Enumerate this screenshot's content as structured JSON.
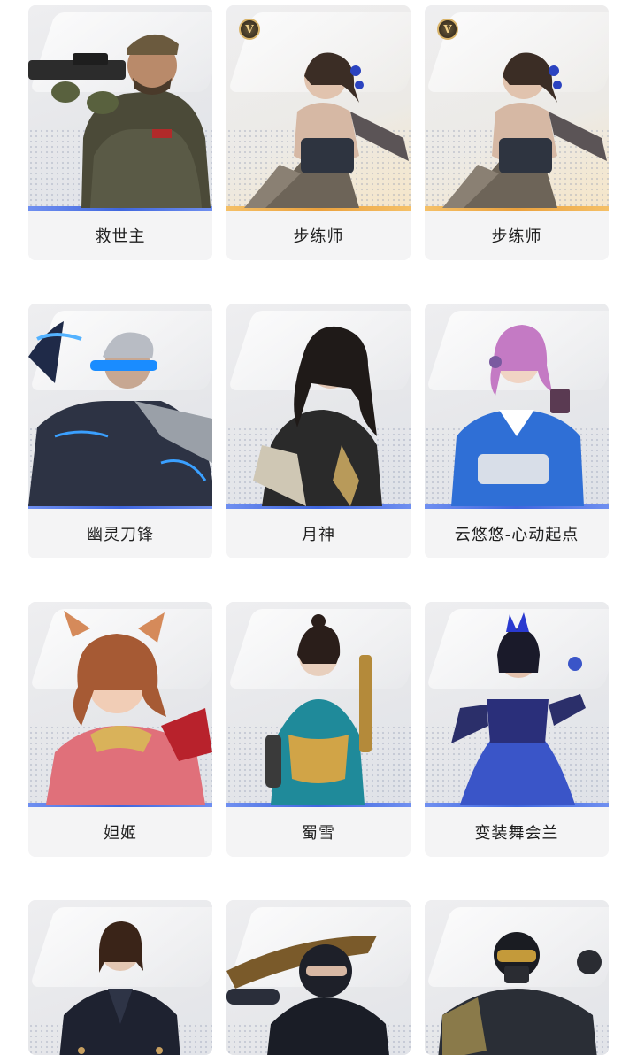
{
  "characters": [
    {
      "name": "救世主",
      "vip": false,
      "badge": "",
      "accent": "#3f66de"
    },
    {
      "name": "步练师",
      "vip": true,
      "badge": "V",
      "accent": "#eba13d"
    },
    {
      "name": "步练师",
      "vip": true,
      "badge": "V",
      "accent": "#eba13d"
    },
    {
      "name": "幽灵刀锋",
      "vip": false,
      "badge": "",
      "accent": "#3f66de"
    },
    {
      "name": "月神",
      "vip": false,
      "badge": "",
      "accent": "#3f66de"
    },
    {
      "name": "云悠悠-心动起点",
      "vip": false,
      "badge": "",
      "accent": "#3f66de"
    },
    {
      "name": "妲姬",
      "vip": false,
      "badge": "",
      "accent": "#3f66de"
    },
    {
      "name": "蜀雪",
      "vip": false,
      "badge": "",
      "accent": "#3f66de"
    },
    {
      "name": "变装舞会兰",
      "vip": false,
      "badge": "",
      "accent": "#3f66de"
    },
    {
      "name": "",
      "vip": false,
      "badge": "",
      "accent": "#3f66de"
    },
    {
      "name": "",
      "vip": false,
      "badge": "",
      "accent": "#3f66de"
    },
    {
      "name": "",
      "vip": false,
      "badge": "",
      "accent": "#3f66de"
    }
  ]
}
